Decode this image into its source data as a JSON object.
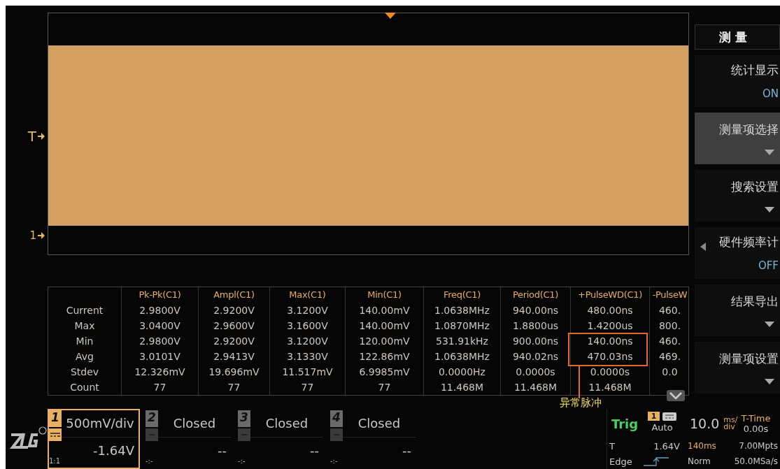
{
  "waveform": {
    "trigger_label": "T",
    "channel_label": "1"
  },
  "table": {
    "row_labels": [
      "Current",
      "Max",
      "Min",
      "Avg",
      "Stdev",
      "Count"
    ],
    "columns": [
      {
        "header": "Pk-Pk(C1)",
        "values": [
          "2.9800V",
          "3.0400V",
          "2.9800V",
          "3.0101V",
          "12.326mV",
          "77"
        ]
      },
      {
        "header": "Ampl(C1)",
        "values": [
          "2.9200V",
          "2.9600V",
          "2.9200V",
          "2.9413V",
          "19.696mV",
          "77"
        ]
      },
      {
        "header": "Max(C1)",
        "values": [
          "3.1200V",
          "3.1600V",
          "3.1200V",
          "3.1330V",
          "11.517mV",
          "77"
        ]
      },
      {
        "header": "Min(C1)",
        "values": [
          "140.00mV",
          "140.00mV",
          "120.00mV",
          "122.86mV",
          "6.9985mV",
          "77"
        ]
      },
      {
        "header": "Freq(C1)",
        "values": [
          "1.0638MHz",
          "1.0870MHz",
          "531.91kHz",
          "1.0638MHz",
          "0.0000Hz",
          "11.468M"
        ]
      },
      {
        "header": "Period(C1)",
        "values": [
          "940.00ns",
          "1.8800us",
          "900.00ns",
          "940.02ns",
          "0.0000s",
          "11.468M"
        ]
      },
      {
        "header": "+PulseWD(C1)",
        "values": [
          "480.00ns",
          "1.4200us",
          "140.00ns",
          "470.03ns",
          "0.0000s",
          "11.468M"
        ]
      },
      {
        "header": "-PulseW",
        "values": [
          "460.",
          "800.",
          "460.",
          "469.",
          "0.0"
        ]
      }
    ]
  },
  "annotation": {
    "label": "异常脉冲"
  },
  "menu": {
    "title": "测 量",
    "items": [
      {
        "label": "统计显示",
        "kind": "value",
        "value": "ON",
        "selected": false,
        "left_arrow": false
      },
      {
        "label": "测量项选择",
        "kind": "dropdown",
        "selected": true,
        "left_arrow": false
      },
      {
        "label": "搜索设置",
        "kind": "dropdown",
        "selected": false,
        "left_arrow": false
      },
      {
        "label": "硬件频率计",
        "kind": "value",
        "value": "OFF",
        "selected": false,
        "left_arrow": true
      },
      {
        "label": "结果导出",
        "kind": "dropdown",
        "selected": false,
        "left_arrow": false
      },
      {
        "label": "测量项设置",
        "kind": "dropdown",
        "selected": false,
        "left_arrow": false
      }
    ]
  },
  "channels": [
    {
      "number": "1",
      "selected": true,
      "scale": "500mV/div",
      "offset": "-1.64V",
      "probe": "1:1"
    },
    {
      "number": "2",
      "selected": false,
      "scale": "Closed",
      "offset": "--",
      "probe": "-:-"
    },
    {
      "number": "3",
      "selected": false,
      "scale": "Closed",
      "offset": "--",
      "probe": "-:-"
    },
    {
      "number": "4",
      "selected": false,
      "scale": "Closed",
      "offset": "--",
      "probe": "-:-"
    }
  ],
  "trigger": {
    "title": "Trig",
    "source": "1",
    "mode": "Auto",
    "level_label": "T",
    "trigger_level": "1.64V",
    "type": "Edge"
  },
  "timebase": {
    "scale": "10.0",
    "unit_top": "ms/",
    "unit_bottom": "div",
    "delay_label": "T-Time",
    "delay": "0.00s",
    "window": "140ms",
    "depth": "7.00Mpts",
    "acq_mode": "Norm",
    "sample_rate": "50.0MSa/s"
  }
}
